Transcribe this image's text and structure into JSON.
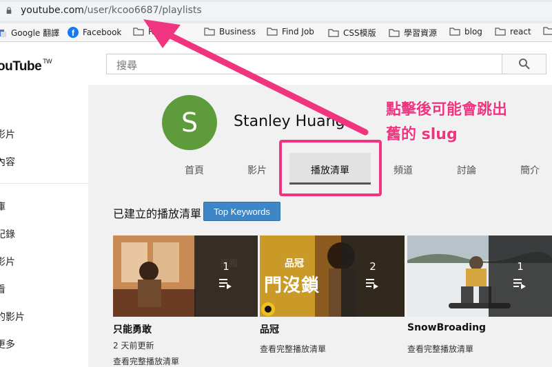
{
  "browser": {
    "url_host": "youtube.com",
    "url_path": "/user/kcoo6687/playlists",
    "bookmarks": [
      {
        "label": "Google 翻譯",
        "icon": "google-translate-icon"
      },
      {
        "label": "Facebook",
        "icon": "facebook-icon"
      },
      {
        "label": "Rails",
        "icon": "folder-icon"
      },
      {
        "label": "Business",
        "icon": "folder-icon"
      },
      {
        "label": "Find Job",
        "icon": "folder-icon"
      },
      {
        "label": "CSS模版",
        "icon": "folder-icon"
      },
      {
        "label": "學習資源",
        "icon": "folder-icon"
      },
      {
        "label": "blog",
        "icon": "folder-icon"
      },
      {
        "label": "react",
        "icon": "folder-icon"
      }
    ]
  },
  "masthead": {
    "logo": "ouTube",
    "logo_region": "TW",
    "search_placeholder": "搜尋"
  },
  "sidebar": {
    "items": [
      {
        "label": "影片"
      },
      {
        "label": "內容"
      },
      {
        "label": "庫"
      },
      {
        "label": "記錄"
      },
      {
        "label": "影片"
      },
      {
        "label": "看"
      },
      {
        "label": "的影片"
      },
      {
        "label": "更多"
      }
    ]
  },
  "channel": {
    "avatar_letter": "S",
    "name": "Stanley Huang",
    "tabs": [
      {
        "label": "首頁",
        "active": false
      },
      {
        "label": "影片",
        "active": false
      },
      {
        "label": "播放清單",
        "active": true
      },
      {
        "label": "頻道",
        "active": false
      },
      {
        "label": "討論",
        "active": false
      },
      {
        "label": "簡介",
        "active": false
      }
    ]
  },
  "playlists": {
    "section_title": "已建立的播放清單",
    "keywords_button": "Top Keywords",
    "items": [
      {
        "title": "只能勇敢",
        "count": "1",
        "updated": "2 天前更新",
        "view_all": "查看完整播放清單"
      },
      {
        "title": "品冠",
        "count": "2",
        "view_all": "查看完整播放清單",
        "thumb_text_top": "品冠",
        "thumb_text_main": "門沒鎖"
      },
      {
        "title": "SnowBroading",
        "count": "1",
        "view_all": "查看完整播放清單"
      }
    ]
  },
  "annotation": {
    "line1": "點擊後可能會跳出",
    "line2": "舊的 slug",
    "color": "#f0347f"
  }
}
